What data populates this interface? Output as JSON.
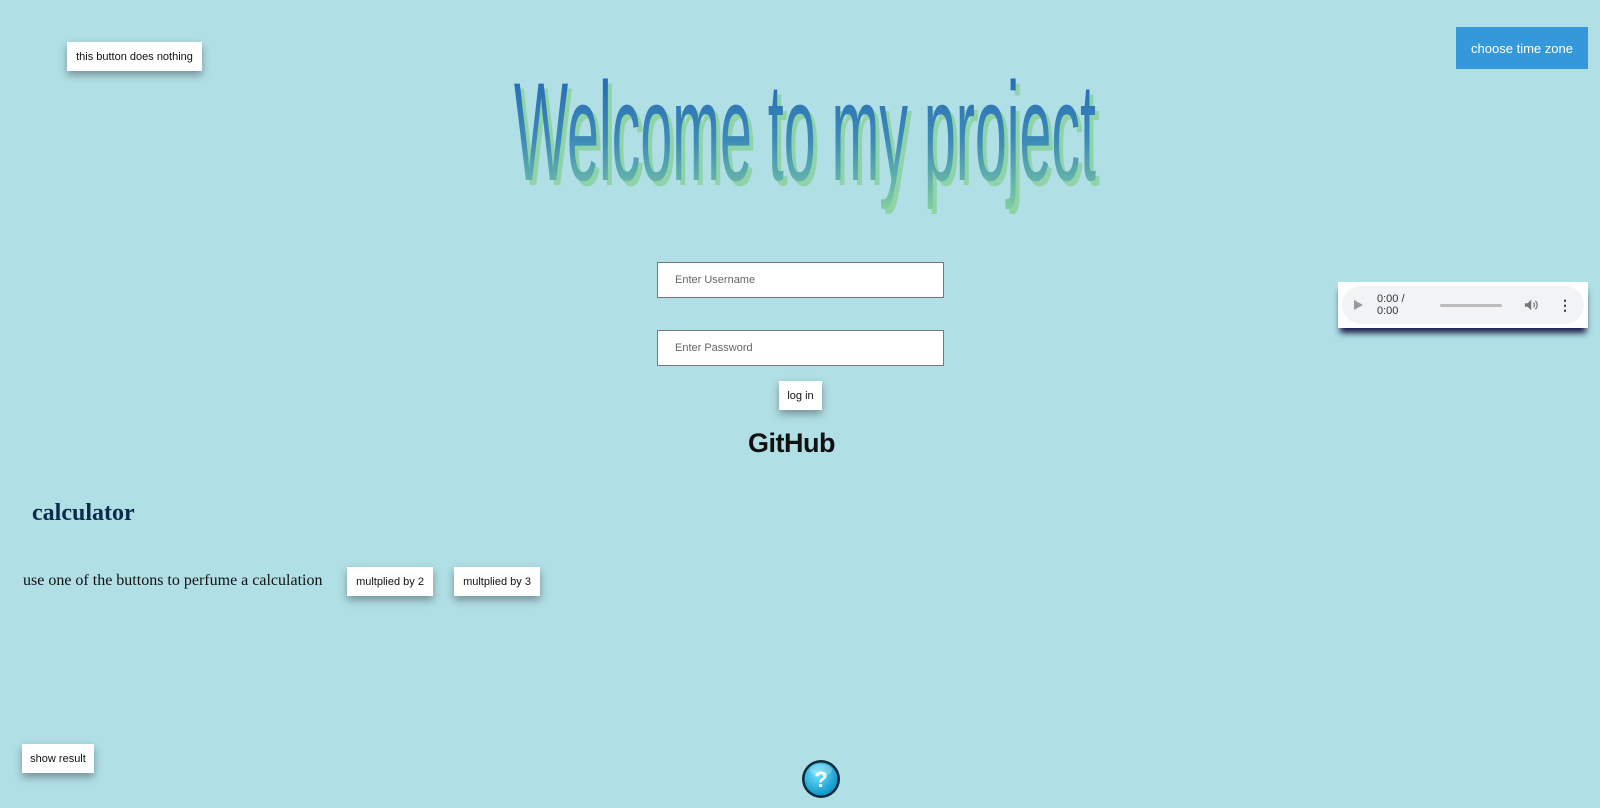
{
  "page": {
    "background": "#b0dfe5"
  },
  "header": {
    "noop_button_label": "this button does nothing",
    "timezone_button_label": "choose time zone",
    "title": "Welcome to my project"
  },
  "login": {
    "username_placeholder": "Enter Username",
    "password_placeholder": "Enter Password",
    "login_button_label": "log in"
  },
  "links": {
    "github_label": "GitHub"
  },
  "audio": {
    "time": "0:00 / 0:00",
    "icons": [
      "play-icon",
      "volume-icon",
      "more-options-icon"
    ]
  },
  "calculator": {
    "title": "calculator",
    "description": "use one of the buttons to perfume a calculation",
    "multiply2_label": "multplied by 2",
    "multiply3_label": "multplied by 3",
    "show_result_label": "show result"
  },
  "help": {
    "icon": "question-mark-icon",
    "glyph": "?"
  },
  "colors": {
    "accent_blue": "#3498db",
    "title_blue": "#1e5fb4",
    "title_green": "#7fcfa0",
    "heading_navy": "#0c2a4a"
  }
}
